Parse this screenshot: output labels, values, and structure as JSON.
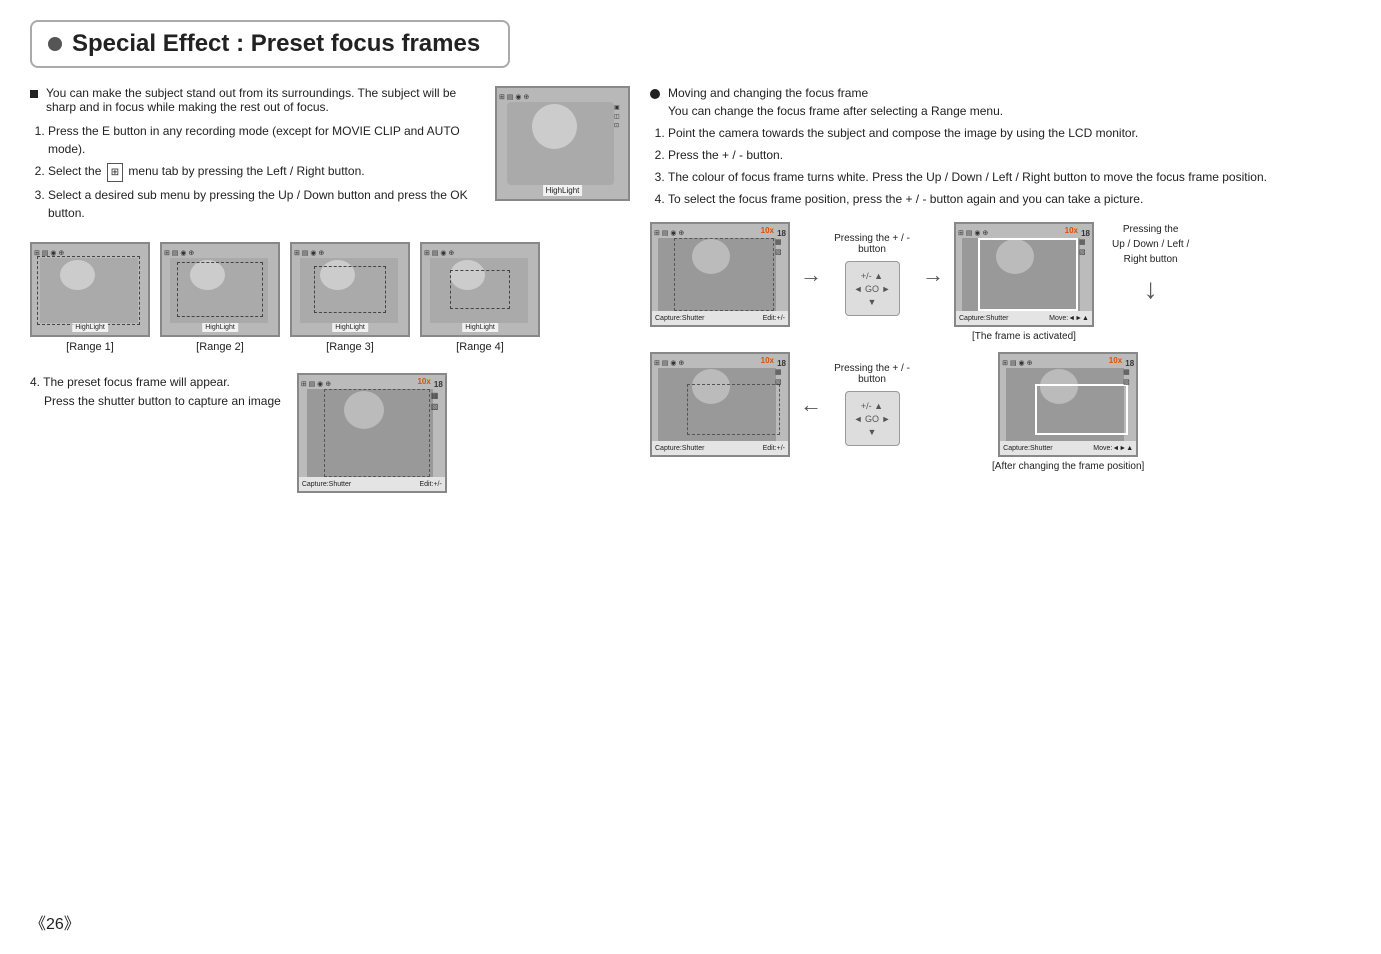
{
  "page": {
    "title": "Special Effect : Preset focus frames",
    "page_number": "《26》"
  },
  "left": {
    "intro_bullet": "You can make the subject stand out from its surroundings. The subject will be sharp and in focus while making the rest out of focus.",
    "steps": [
      "Press the E button in any recording mode (except for MOVIE CLIP and AUTO mode).",
      "Select the   menu tab by pressing the Left / Right button.",
      "Select a desired sub menu by pressing the Up / Down button and press the OK button."
    ],
    "highlight_label": "HighLight",
    "ranges": [
      {
        "label": "[Range 1]"
      },
      {
        "label": "[Range 2]"
      },
      {
        "label": "[Range 3]"
      },
      {
        "label": "[Range 4]"
      }
    ],
    "step4_text": "4. The preset focus frame will appear.\n   Press the shutter button to capture an image",
    "bottom_screen_labels": {
      "capture": "Capture:Shutter",
      "edit": "Edit:+/-"
    }
  },
  "right": {
    "moving_title": "Moving and changing the focus frame",
    "moving_desc": "You can change the focus frame after selecting a Range menu.",
    "steps": [
      "Point the camera towards the subject and compose the image by using the LCD monitor.",
      "Press the + / - button.",
      "The colour of focus frame turns white. Press the Up / Down / Left / Right button to move the focus frame position.",
      "To select the focus frame position, press the + / - button again and you can take a picture."
    ],
    "pressing_plus_label": "Pressing the + / - button",
    "pressing_label": "Pressing the button",
    "frame_activated_label": "[The frame is activated]",
    "pressing_up_label": "Pressing the\nUp / Down / Left /\nRight button",
    "after_change_label": "[After changing the frame position]",
    "screens": {
      "capture": "Capture:Shutter",
      "edit": "Edit:+/-",
      "move": "Move:◄► ▲"
    }
  }
}
